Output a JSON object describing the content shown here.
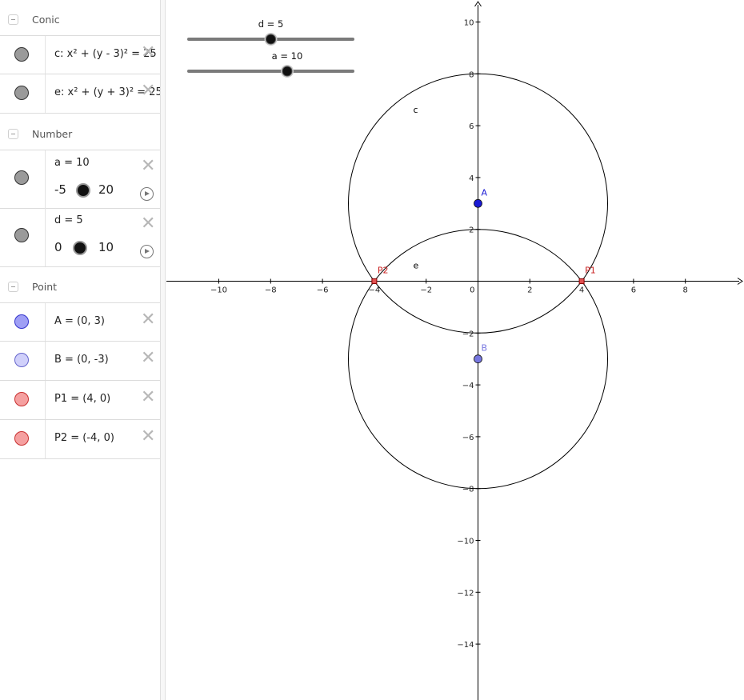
{
  "algebra": {
    "groups": [
      {
        "title": "Conic",
        "items": [
          {
            "expr": "c: x² + (y - 3)² = 25"
          },
          {
            "expr": "e: x² + (y + 3)² = 25"
          }
        ]
      },
      {
        "title": "Number",
        "items": [
          {
            "expr": "a = 10",
            "min": "-5",
            "max": "20",
            "value": 10
          },
          {
            "expr": "d = 5",
            "min": "0",
            "max": "10",
            "value": 5
          }
        ]
      },
      {
        "title": "Point",
        "items": [
          {
            "expr": "A = (0, 3)",
            "color": "#9f9ff5"
          },
          {
            "expr": "B = (0, -3)",
            "color": "#d0d0fa"
          },
          {
            "expr": "P1 = (4, 0)",
            "color": "#f5a0a0"
          },
          {
            "expr": "P2 = (-4, 0)",
            "color": "#f5a0a0"
          }
        ]
      }
    ],
    "marble_gray": "#9a9a9a"
  },
  "graphics": {
    "sliders": [
      {
        "label": "d = 5",
        "value": 5,
        "min": 0,
        "max": 10
      },
      {
        "label": "a = 10",
        "value": 10,
        "min": -5,
        "max": 20
      }
    ],
    "x_ticks": [
      "−10",
      "−8",
      "−6",
      "−4",
      "−2",
      "0",
      "2",
      "4",
      "6",
      "8"
    ],
    "y_ticks": [
      "10",
      "8",
      "6",
      "4",
      "2",
      "−2",
      "−4",
      "−6",
      "−8",
      "−10",
      "−12",
      "−14"
    ],
    "circles": [
      {
        "label": "c",
        "center": [
          0,
          3
        ],
        "radius": 5
      },
      {
        "label": "e",
        "center": [
          0,
          -3
        ],
        "radius": 5
      }
    ],
    "points": [
      {
        "label": "A",
        "x": 0,
        "y": 3,
        "color": "#1a1ad4"
      },
      {
        "label": "B",
        "x": 0,
        "y": -3,
        "color": "#7777e0"
      },
      {
        "label": "P1",
        "x": 4,
        "y": 0,
        "color": "#c81e1e"
      },
      {
        "label": "P2",
        "x": -4,
        "y": 0,
        "color": "#c81e1e"
      }
    ]
  }
}
